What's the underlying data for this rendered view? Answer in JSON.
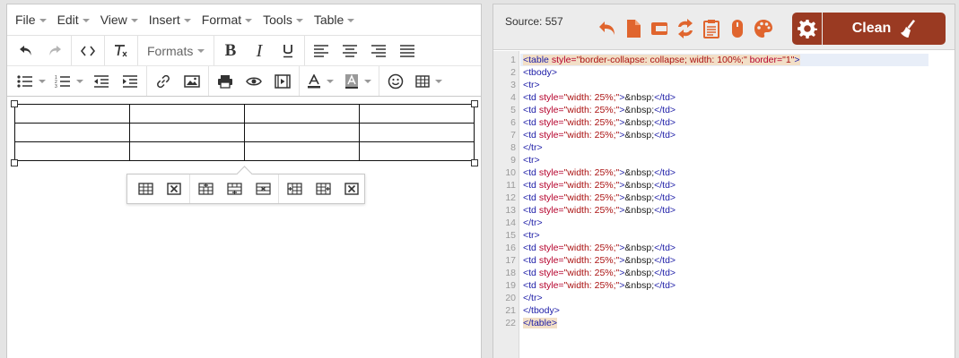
{
  "menubar": {
    "items": [
      "File",
      "Edit",
      "View",
      "Insert",
      "Format",
      "Tools",
      "Table"
    ]
  },
  "toolbar": {
    "formats_label": "Formats"
  },
  "source_panel": {
    "label": "Source: 557",
    "clean_label": "Clean",
    "accent_color": "#9a3a22",
    "icon_color": "#e0652e",
    "code": [
      {
        "n": "1",
        "tokens": [
          [
            "tag",
            "<table "
          ],
          [
            "attr",
            "style="
          ],
          [
            "str",
            "\"border-collapse: collapse; width: 100%;\""
          ],
          [
            "attr",
            " border="
          ],
          [
            "str",
            "\"1\""
          ],
          [
            "tag",
            ">"
          ]
        ]
      },
      {
        "n": "2",
        "tokens": [
          [
            "tag",
            "<tbody>"
          ]
        ]
      },
      {
        "n": "3",
        "tokens": [
          [
            "tag",
            "<tr>"
          ]
        ]
      },
      {
        "n": "4",
        "tokens": [
          [
            "tag",
            "<td "
          ],
          [
            "attr",
            "style="
          ],
          [
            "str",
            "\"width: 25%;\""
          ],
          [
            "tag",
            ">"
          ],
          [
            "ent",
            "&nbsp;"
          ],
          [
            "tag",
            "</td>"
          ]
        ]
      },
      {
        "n": "5",
        "tokens": [
          [
            "tag",
            "<td "
          ],
          [
            "attr",
            "style="
          ],
          [
            "str",
            "\"width: 25%;\""
          ],
          [
            "tag",
            ">"
          ],
          [
            "ent",
            "&nbsp;"
          ],
          [
            "tag",
            "</td>"
          ]
        ]
      },
      {
        "n": "6",
        "tokens": [
          [
            "tag",
            "<td "
          ],
          [
            "attr",
            "style="
          ],
          [
            "str",
            "\"width: 25%;\""
          ],
          [
            "tag",
            ">"
          ],
          [
            "ent",
            "&nbsp;"
          ],
          [
            "tag",
            "</td>"
          ]
        ]
      },
      {
        "n": "7",
        "tokens": [
          [
            "tag",
            "<td "
          ],
          [
            "attr",
            "style="
          ],
          [
            "str",
            "\"width: 25%;\""
          ],
          [
            "tag",
            ">"
          ],
          [
            "ent",
            "&nbsp;"
          ],
          [
            "tag",
            "</td>"
          ]
        ]
      },
      {
        "n": "8",
        "tokens": [
          [
            "tag",
            "</tr>"
          ]
        ]
      },
      {
        "n": "9",
        "tokens": [
          [
            "tag",
            "<tr>"
          ]
        ]
      },
      {
        "n": "10",
        "tokens": [
          [
            "tag",
            "<td "
          ],
          [
            "attr",
            "style="
          ],
          [
            "str",
            "\"width: 25%;\""
          ],
          [
            "tag",
            ">"
          ],
          [
            "ent",
            "&nbsp;"
          ],
          [
            "tag",
            "</td>"
          ]
        ]
      },
      {
        "n": "11",
        "tokens": [
          [
            "tag",
            "<td "
          ],
          [
            "attr",
            "style="
          ],
          [
            "str",
            "\"width: 25%;\""
          ],
          [
            "tag",
            ">"
          ],
          [
            "ent",
            "&nbsp;"
          ],
          [
            "tag",
            "</td>"
          ]
        ]
      },
      {
        "n": "12",
        "tokens": [
          [
            "tag",
            "<td "
          ],
          [
            "attr",
            "style="
          ],
          [
            "str",
            "\"width: 25%;\""
          ],
          [
            "tag",
            ">"
          ],
          [
            "ent",
            "&nbsp;"
          ],
          [
            "tag",
            "</td>"
          ]
        ]
      },
      {
        "n": "13",
        "tokens": [
          [
            "tag",
            "<td "
          ],
          [
            "attr",
            "style="
          ],
          [
            "str",
            "\"width: 25%;\""
          ],
          [
            "tag",
            ">"
          ],
          [
            "ent",
            "&nbsp;"
          ],
          [
            "tag",
            "</td>"
          ]
        ]
      },
      {
        "n": "14",
        "tokens": [
          [
            "tag",
            "</tr>"
          ]
        ]
      },
      {
        "n": "15",
        "tokens": [
          [
            "tag",
            "<tr>"
          ]
        ]
      },
      {
        "n": "16",
        "tokens": [
          [
            "tag",
            "<td "
          ],
          [
            "attr",
            "style="
          ],
          [
            "str",
            "\"width: 25%;\""
          ],
          [
            "tag",
            ">"
          ],
          [
            "ent",
            "&nbsp;"
          ],
          [
            "tag",
            "</td>"
          ]
        ]
      },
      {
        "n": "17",
        "tokens": [
          [
            "tag",
            "<td "
          ],
          [
            "attr",
            "style="
          ],
          [
            "str",
            "\"width: 25%;\""
          ],
          [
            "tag",
            ">"
          ],
          [
            "ent",
            "&nbsp;"
          ],
          [
            "tag",
            "</td>"
          ]
        ]
      },
      {
        "n": "18",
        "tokens": [
          [
            "tag",
            "<td "
          ],
          [
            "attr",
            "style="
          ],
          [
            "str",
            "\"width: 25%;\""
          ],
          [
            "tag",
            ">"
          ],
          [
            "ent",
            "&nbsp;"
          ],
          [
            "tag",
            "</td>"
          ]
        ]
      },
      {
        "n": "19",
        "tokens": [
          [
            "tag",
            "<td "
          ],
          [
            "attr",
            "style="
          ],
          [
            "str",
            "\"width: 25%;\""
          ],
          [
            "tag",
            ">"
          ],
          [
            "ent",
            "&nbsp;"
          ],
          [
            "tag",
            "</td>"
          ]
        ]
      },
      {
        "n": "20",
        "tokens": [
          [
            "tag",
            "</tr>"
          ]
        ]
      },
      {
        "n": "21",
        "tokens": [
          [
            "tag",
            "</tbody>"
          ]
        ]
      },
      {
        "n": "22",
        "tokens": [
          [
            "tag",
            "</table>"
          ]
        ]
      }
    ]
  }
}
